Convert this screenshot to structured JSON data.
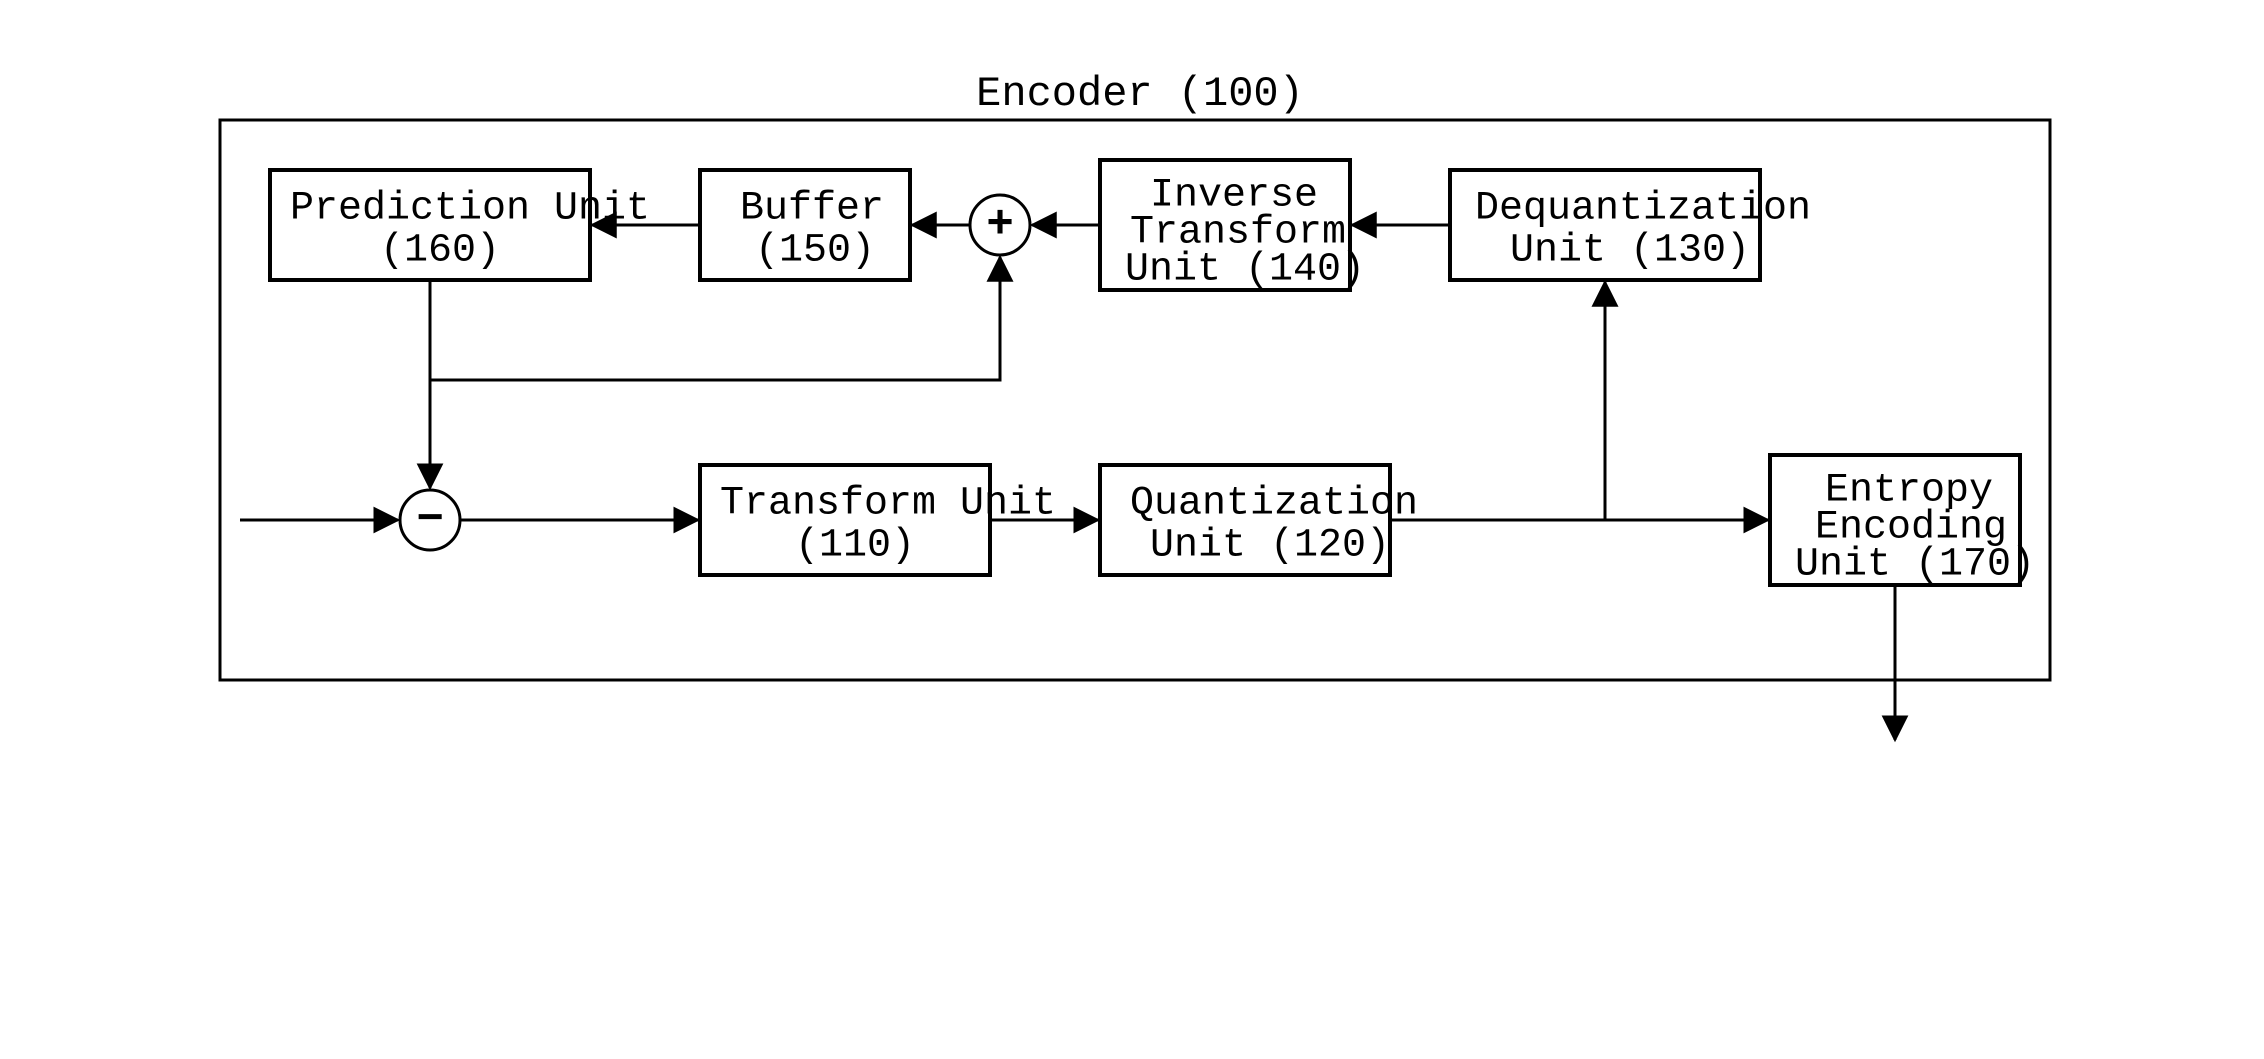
{
  "chart_data": {
    "type": "block-diagram",
    "title": "Encoder (100)",
    "nodes": [
      {
        "id": "input",
        "kind": "port"
      },
      {
        "id": "subtract",
        "kind": "op",
        "symbol": "−"
      },
      {
        "id": "transform",
        "kind": "block",
        "label": "Transform Unit\n(110)"
      },
      {
        "id": "quant",
        "kind": "block",
        "label": "Quantization\nUnit (120)"
      },
      {
        "id": "dequant",
        "kind": "block",
        "label": "Dequantization\nUnit (130)"
      },
      {
        "id": "itrans",
        "kind": "block",
        "label": "Inverse\nTransform\nUnit (140)"
      },
      {
        "id": "add",
        "kind": "op",
        "symbol": "+"
      },
      {
        "id": "buffer",
        "kind": "block",
        "label": "Buffer\n(150)"
      },
      {
        "id": "pred",
        "kind": "block",
        "label": "Prediction Unit\n(160)"
      },
      {
        "id": "entropy",
        "kind": "block",
        "label": "Entropy\nEncoding\nUnit (170)"
      },
      {
        "id": "output",
        "kind": "port"
      }
    ],
    "edges": [
      {
        "from": "input",
        "to": "subtract",
        "via": []
      },
      {
        "from": "subtract",
        "to": "transform",
        "via": []
      },
      {
        "from": "transform",
        "to": "quant",
        "via": []
      },
      {
        "from": "quant",
        "to": "entropy",
        "via": []
      },
      {
        "from": "quant",
        "to": "dequant",
        "via": [
          "up"
        ]
      },
      {
        "from": "dequant",
        "to": "itrans",
        "via": []
      },
      {
        "from": "itrans",
        "to": "add",
        "via": []
      },
      {
        "from": "add",
        "to": "buffer",
        "via": []
      },
      {
        "from": "buffer",
        "to": "pred",
        "via": []
      },
      {
        "from": "pred",
        "to": "subtract",
        "via": [
          "down"
        ]
      },
      {
        "from": "pred",
        "to": "add",
        "via": [
          "down",
          "right",
          "up"
        ]
      },
      {
        "from": "entropy",
        "to": "output",
        "via": [
          "down"
        ]
      }
    ]
  },
  "title": "Encoder (100)",
  "blocks": {
    "pred": {
      "l1": "Prediction Unit",
      "l2": "(160)"
    },
    "buffer": {
      "l1": "Buffer",
      "l2": "(150)"
    },
    "itrans": {
      "l1": "Inverse",
      "l2": "Transform",
      "l3": "Unit (140)"
    },
    "dequant": {
      "l1": "Dequantization",
      "l2": "Unit (130)"
    },
    "transform": {
      "l1": "Transform Unit",
      "l2": "(110)"
    },
    "quant": {
      "l1": "Quantization",
      "l2": "Unit (120)"
    },
    "entropy": {
      "l1": "Entropy",
      "l2": "Encoding",
      "l3": "Unit (170)"
    }
  },
  "ops": {
    "add": "+",
    "sub": "−"
  }
}
